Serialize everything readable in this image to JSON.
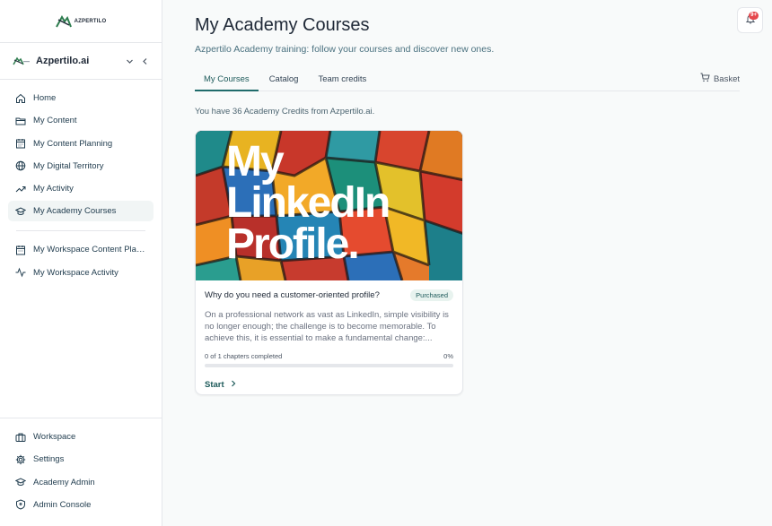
{
  "brand": {
    "logo_text": "AZPERTILO",
    "accent": "#1f6b6b"
  },
  "workspace": {
    "name": "Azpertilo.ai",
    "chevron_icon": "chevron-down-icon",
    "collapse_icon": "chevron-left-icon"
  },
  "sidebar": {
    "items": [
      {
        "label": "Home",
        "icon": "home-icon",
        "active": false
      },
      {
        "label": "My Content",
        "icon": "folder-icon",
        "active": false
      },
      {
        "label": "My Content Planning",
        "icon": "calendar-icon",
        "active": false
      },
      {
        "label": "My Digital Territory",
        "icon": "globe-icon",
        "active": false
      },
      {
        "label": "My Activity",
        "icon": "trend-icon",
        "active": false
      },
      {
        "label": "My Academy Courses",
        "icon": "graduation-cap-icon",
        "active": true
      }
    ],
    "workspace_items": [
      {
        "label": "My Workspace Content Planning",
        "icon": "calendar-icon"
      },
      {
        "label": "My Workspace Activity",
        "icon": "activity-icon"
      }
    ],
    "bottom_items": [
      {
        "label": "Workspace",
        "icon": "briefcase-icon"
      },
      {
        "label": "Settings",
        "icon": "gear-icon"
      },
      {
        "label": "Academy Admin",
        "icon": "graduation-cap-icon"
      },
      {
        "label": "Admin Console",
        "icon": "shield-icon"
      }
    ]
  },
  "header": {
    "title": "My Academy Courses",
    "subtitle": "Azpertilo Academy training: follow your courses and discover new ones.",
    "notification_badge": "9+"
  },
  "tabs": [
    {
      "label": "My Courses",
      "active": true
    },
    {
      "label": "Catalog",
      "active": false
    },
    {
      "label": "Team credits",
      "active": false
    }
  ],
  "basket_label": "Basket",
  "credits_text": "You have 36 Academy Credits from Azpertilo.ai.",
  "course": {
    "cover_lines": [
      "My",
      "LinkedIn",
      "Profile."
    ],
    "title": "Why do you need a customer-oriented profile?",
    "status": "Purchased",
    "description": "On a professional network as vast as LinkedIn, simple visibility is no longer enough; the challenge is to become memorable. To achieve this, it is essential to make a fundamental change:...",
    "progress_text": "0 of 1 chapters completed",
    "progress_percent": "0%",
    "progress_value": 0,
    "start_label": "Start"
  }
}
